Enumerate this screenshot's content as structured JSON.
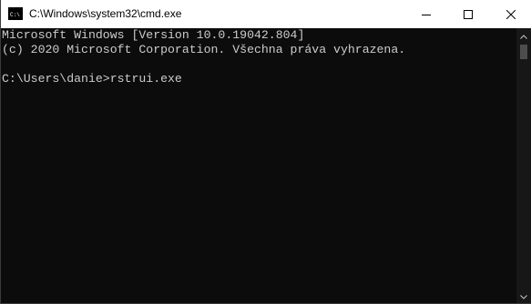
{
  "window": {
    "title": "C:\\Windows\\system32\\cmd.exe",
    "app_icon": "console-icon"
  },
  "caption_buttons": {
    "minimize_icon": "minimize-icon",
    "maximize_icon": "maximize-icon",
    "close_icon": "close-icon"
  },
  "console": {
    "lines": [
      "Microsoft Windows [Version 10.0.19042.804]",
      "(c) 2020 Microsoft Corporation. Všechna práva vyhrazena.",
      "C:\\Users\\danie>rstrui.exe"
    ]
  },
  "colors": {
    "background": "#0c0c0c",
    "text": "#cccccc",
    "titlebar": "#ffffff"
  }
}
